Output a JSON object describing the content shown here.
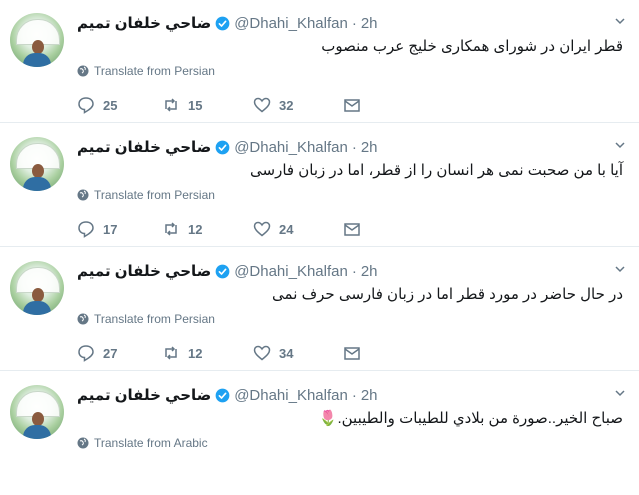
{
  "tweets": [
    {
      "name": "ضاحي خلفان تميم",
      "handle": "@Dhahi_Khalfan",
      "dot": "·",
      "time": "2h",
      "text": "قطر ایران در شورای همکاری خلیج  عرب منصوب",
      "translate": "Translate from Persian",
      "replies": "25",
      "retweets": "15",
      "likes": "32"
    },
    {
      "name": "ضاحي خلفان تميم",
      "handle": "@Dhahi_Khalfan",
      "dot": "·",
      "time": "2h",
      "text": "آیا با من صحبت نمی هر انسان را از قطر، اما در زبان فارسی",
      "translate": "Translate from Persian",
      "replies": "17",
      "retweets": "12",
      "likes": "24"
    },
    {
      "name": "ضاحي خلفان تميم",
      "handle": "@Dhahi_Khalfan",
      "dot": "·",
      "time": "2h",
      "text": "در حال حاضر در مورد قطر اما در زبان فارسی حرف نمی",
      "translate": "Translate from Persian",
      "replies": "27",
      "retweets": "12",
      "likes": "34"
    },
    {
      "name": "ضاحي خلفان تميم",
      "handle": "@Dhahi_Khalfan",
      "dot": "·",
      "time": "2h",
      "text": "صباح الخير..صورة من بلادي للطيبات والطيبين.🌷",
      "translate": "Translate from Arabic",
      "replies": "",
      "retweets": "",
      "likes": ""
    }
  ],
  "colors": {
    "verified": "#1da1f2",
    "muted": "#657786",
    "border": "#e6ecf0"
  }
}
